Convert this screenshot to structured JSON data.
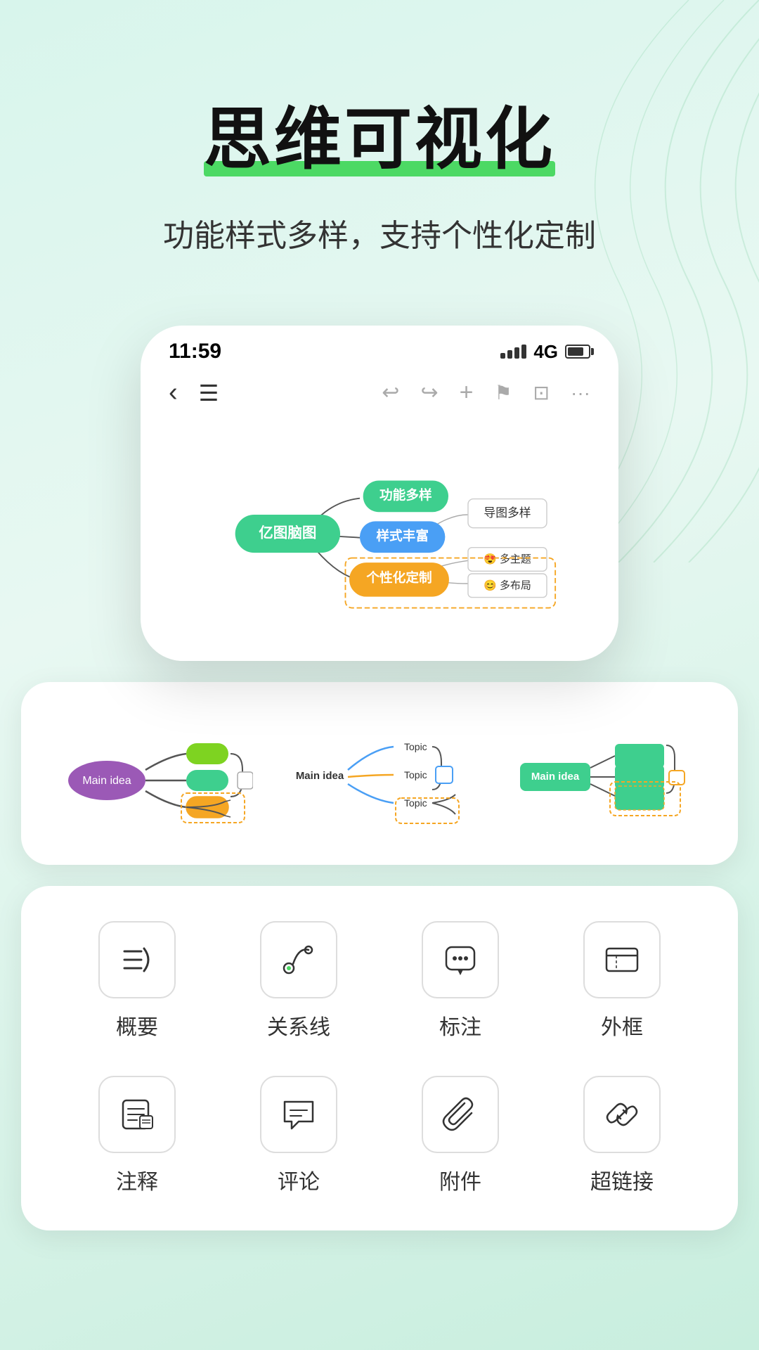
{
  "hero": {
    "title": "思维可视化",
    "subtitle": "功能样式多样，支持个性化定制"
  },
  "phone": {
    "time": "11:59",
    "signal": "4G",
    "toolbar_icons": [
      "‹",
      "≡",
      "↩",
      "↪",
      "+",
      "🏷",
      "💾",
      "···"
    ]
  },
  "mindmap": {
    "center_label": "亿图脑图",
    "nodes": [
      {
        "label": "功能多样",
        "color": "#3ecf8e"
      },
      {
        "label": "样式丰富",
        "color": "#4a9ff5"
      },
      {
        "label": "个性化定制",
        "color": "#f5a623"
      }
    ],
    "right_nodes": [
      {
        "label": "导图多样"
      },
      {
        "label": "😍 多主题"
      },
      {
        "label": "😊 多布局"
      }
    ]
  },
  "templates": [
    {
      "name": "template-fishbone",
      "main_idea": "Main idea",
      "main_idea_color": "#9b59b6"
    },
    {
      "name": "template-curve",
      "main_idea": "Main idea",
      "main_idea_color": "#333"
    },
    {
      "name": "template-box",
      "main_idea": "Main idea",
      "main_idea_color": "#3ecf8e"
    }
  ],
  "features": [
    {
      "id": "summary",
      "label": "概要",
      "icon": "≡}",
      "iconType": "summary"
    },
    {
      "id": "relation",
      "label": "关系线",
      "icon": "↩●",
      "iconType": "relation"
    },
    {
      "id": "mark",
      "label": "标注",
      "icon": "💬",
      "iconType": "mark"
    },
    {
      "id": "frame",
      "label": "外框",
      "icon": "▭=",
      "iconType": "frame"
    },
    {
      "id": "note",
      "label": "注释",
      "icon": "📝",
      "iconType": "note"
    },
    {
      "id": "comment",
      "label": "评论",
      "icon": "✏",
      "iconType": "comment"
    },
    {
      "id": "attachment",
      "label": "附件",
      "icon": "📎",
      "iconType": "attachment"
    },
    {
      "id": "hyperlink",
      "label": "超链接",
      "icon": "🔗",
      "iconType": "hyperlink"
    }
  ],
  "colors": {
    "green": "#3ecf8e",
    "blue": "#4a9ff5",
    "orange": "#f5a623",
    "purple": "#9b59b6",
    "light_green": "#7ed321",
    "teal": "#1abc9c"
  }
}
